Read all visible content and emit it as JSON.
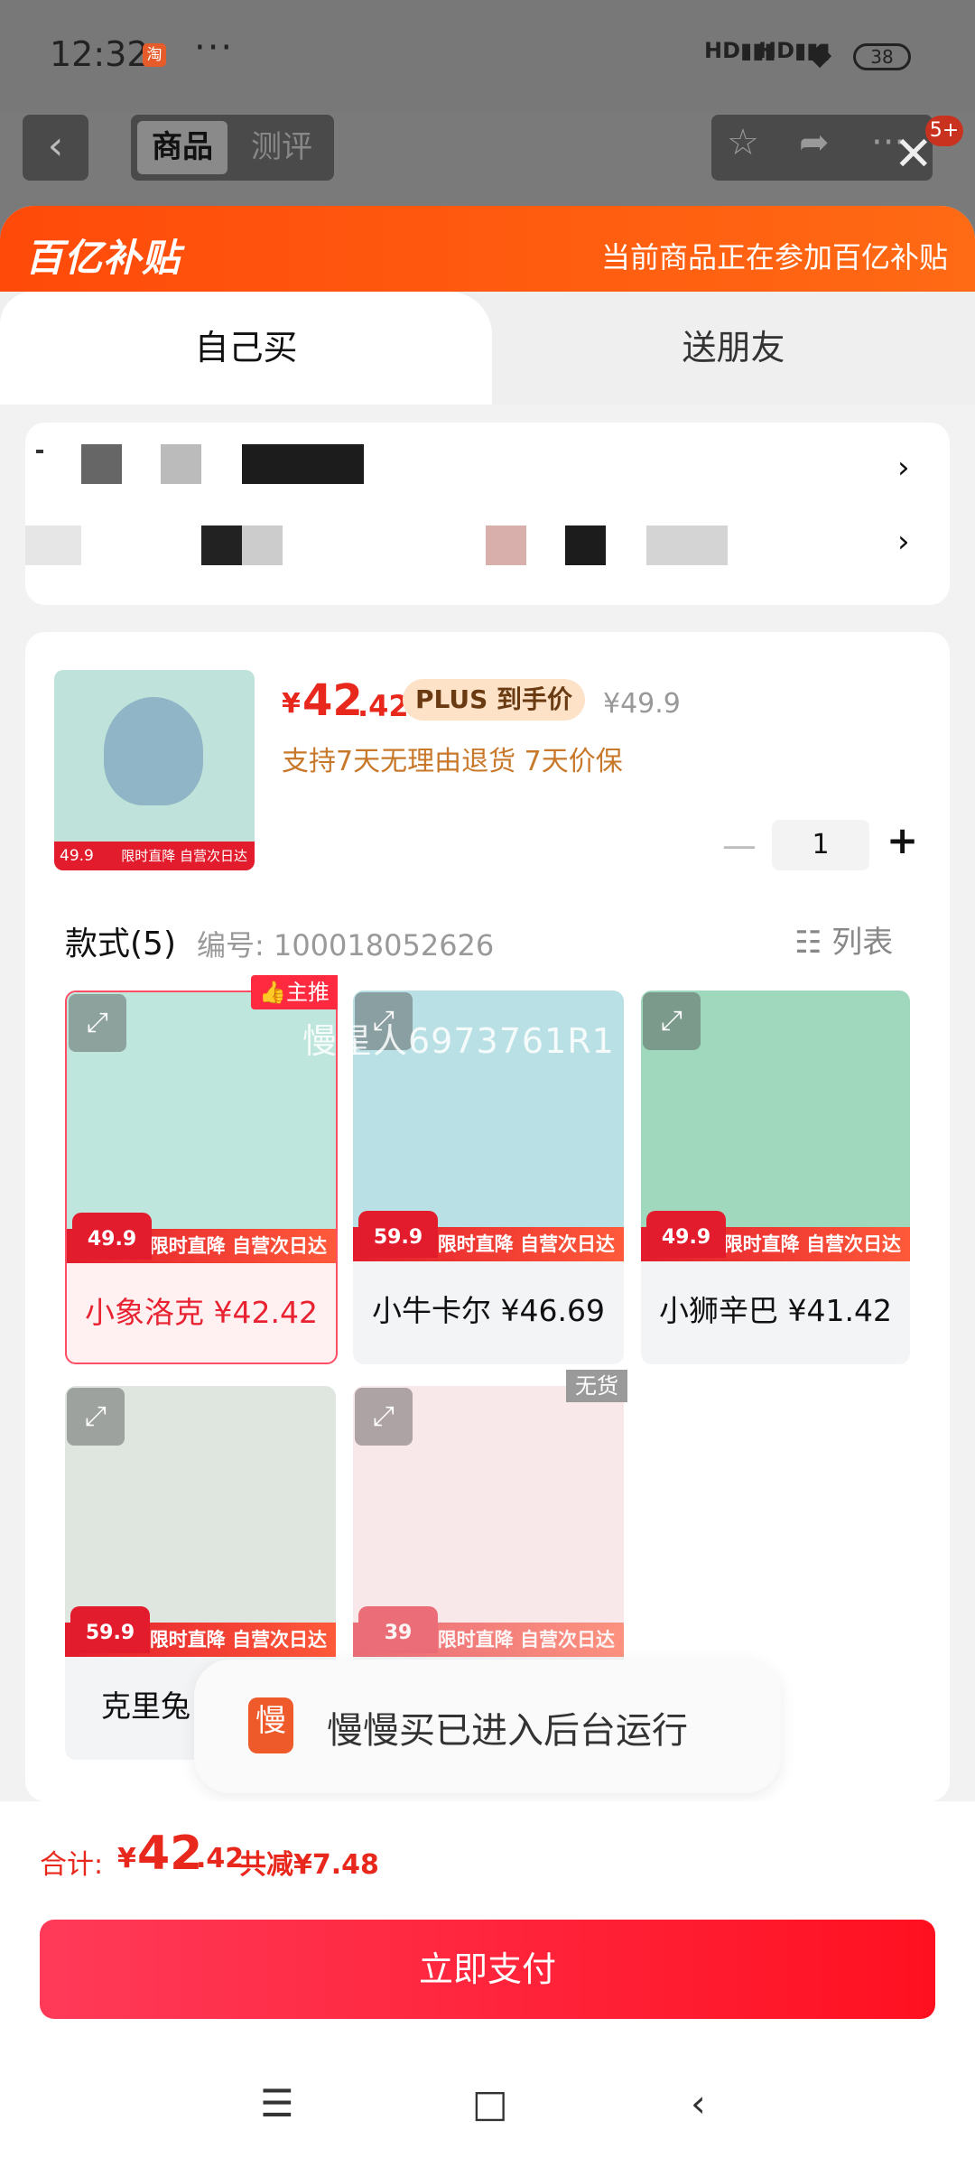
{
  "status_bar": {
    "time": "12:32",
    "app_icon": "淘",
    "more": "···",
    "network": [
      "HD",
      "HD"
    ],
    "battery": "38"
  },
  "page_header": {
    "segments": [
      "商品",
      "测评"
    ],
    "badge": "5+"
  },
  "sheet": {
    "subsidy_logo": "百亿补贴",
    "subsidy_text": "当前商品正在参加百亿补贴",
    "tabs": [
      "自己买",
      "送朋友"
    ]
  },
  "product": {
    "price_symbol": "¥",
    "price_int": "42",
    "price_dec": ".42",
    "plus_tag": "PLUS 到手价",
    "original_price": "¥49.9",
    "guarantee": "支持7天无理由退货  7天价保",
    "quantity": "1",
    "thumb_promo_price": "49.9",
    "thumb_promo_text": "限时直降 自营次日达"
  },
  "styles": {
    "title": "款式(5)",
    "code": "编号: 100018052626",
    "list_label": "列表",
    "top_tag": "主推",
    "out_of_stock": "无货",
    "watermark": "慢星人6973761R1",
    "promo_text": "限时直降 自营次日达",
    "variants": [
      {
        "name": "小象洛克 ¥42.42",
        "promo_price": "49.9",
        "color": "#bfe6dc"
      },
      {
        "name": "小牛卡尔 ¥46.69",
        "promo_price": "59.9",
        "color": "#b9e0e4"
      },
      {
        "name": "小狮辛巴 ¥41.42",
        "promo_price": "49.9",
        "color": "#9fd8bd"
      },
      {
        "name": "克里兔",
        "promo_price": "59.9",
        "color": "#dfe6e0"
      },
      {
        "name": "",
        "promo_price": "39",
        "color": "#fbe4e6"
      }
    ]
  },
  "toast": {
    "icon": "慢",
    "text": "慢慢买已进入后台运行"
  },
  "footer": {
    "total_label": "合计:",
    "total_symbol": "¥",
    "total_int": "42",
    "total_dec": ".42",
    "total_save": "共减¥7.48",
    "pay_label": "立即支付"
  },
  "nav": {
    "menu": "☰",
    "home": "□",
    "back": "‹"
  }
}
